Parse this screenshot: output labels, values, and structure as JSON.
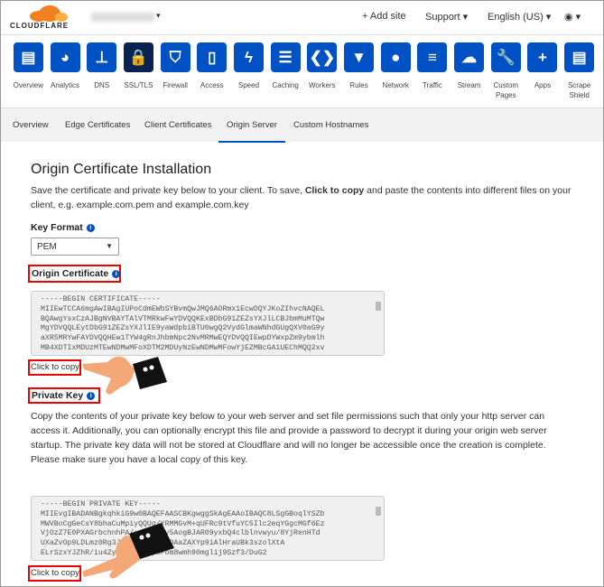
{
  "header": {
    "logo": "CLOUDFLARE",
    "add_site": "+ Add site",
    "support": "Support ▾",
    "language": "English (US) ▾",
    "user": "◉ ▾",
    "account_caret": "▾"
  },
  "nav": [
    {
      "label": "Overview",
      "icon": "clipboard-icon",
      "glyph": "▤"
    },
    {
      "label": "Analytics",
      "icon": "pie-chart-icon",
      "glyph": "◕"
    },
    {
      "label": "DNS",
      "icon": "network-tree-icon",
      "glyph": "⊥"
    },
    {
      "label": "SSL/TLS",
      "icon": "lock-icon",
      "glyph": "🔒",
      "active": true
    },
    {
      "label": "Firewall",
      "icon": "shield-icon",
      "glyph": "⛉"
    },
    {
      "label": "Access",
      "icon": "door-icon",
      "glyph": "▯"
    },
    {
      "label": "Speed",
      "icon": "lightning-icon",
      "glyph": "ϟ"
    },
    {
      "label": "Caching",
      "icon": "server-icon",
      "glyph": "☰"
    },
    {
      "label": "Workers",
      "icon": "workers-icon",
      "glyph": "❮❯"
    },
    {
      "label": "Rules",
      "icon": "filter-icon",
      "glyph": "▼"
    },
    {
      "label": "Network",
      "icon": "location-pin-icon",
      "glyph": "●"
    },
    {
      "label": "Traffic",
      "icon": "list-icon",
      "glyph": "≡"
    },
    {
      "label": "Stream",
      "icon": "cloud-play-icon",
      "glyph": "☁"
    },
    {
      "label": "Custom Pages",
      "icon": "wrench-icon",
      "glyph": "🔧"
    },
    {
      "label": "Apps",
      "icon": "plus-icon",
      "glyph": "+"
    },
    {
      "label": "Scrape Shield",
      "icon": "document-icon",
      "glyph": "▤"
    }
  ],
  "tabs": [
    "Overview",
    "Edge Certificates",
    "Client Certificates",
    "Origin Server",
    "Custom Hostnames"
  ],
  "main": {
    "title": "Origin Certificate Installation",
    "intro_1": "Save the certificate and private key below to your client. To save, ",
    "intro_bold": "Click to copy",
    "intro_2": " and paste the contents into different files on your client, e.g. example.com.pem and example.com.key",
    "key_format_label": "Key Format",
    "key_format_value": "PEM",
    "origin_cert_label": "Origin Certificate",
    "origin_cert_text": "-----BEGIN CERTIFICATE-----\nMIIEwTCCA6mgAwIBAgIUPoCdmEWbSYBvmQwJMQ6AORmx1EcwDQYJKoZIhvcNAQEL\nBQAwgYsxCzAJBgNVBAYTAlVTMRkwFwYDVQQKExBDbG91ZEZsYXJlLCBJbmMuMTQw\nMgYDVQQLEytDbG91ZEZsYXJlIE9yaWdpbiBTU0wgQ2VydGlmaWNhdGUgQXV0aG9y\naXR5MRYwFAYDVQQHEw1TYW4gRnJhbmNpc2NvMRMwEQYDVQQIEwpDYWxpZm9ybmlh\nMB4XDTIxMDUzMTEwNDMwMFoXDTM2MDUyNzEwNDMwMFowYjEZMBcGA1UEChMQQ2xv",
    "copy_label": "Click to copy",
    "private_key_label": "Private Key",
    "private_key_desc": "Copy the contents of your private key below to your web server and set file permissions such that only your http server can access it. Additionally, you can optionally encrypt this file and provide a password to decrypt it during your origin web server startup. The private key data will not be stored at Cloudflare and will no longer be accessible once the creation is complete. Please make sure you have a local copy of this key.",
    "private_key_text": "-----BEGIN PRIVATE KEY-----\nMIIEvgIBADANBgkqhkiG9w0BAQEFAASCBKgwggSkAgEAAoIBAQC8LSgGBoqlYSZb\nMWVBoCgGeCsY8bhaCuMpiyQQUg/YRMMGvM+qUFRc9tVfuYC5Ilc2eqYGgcMGf6Ez\nVjOzZ7E0PXAGrbchnhPA/+g+9oM4v5AogBJAR09yxbQ4clblnvwyu/8YjRenHTd\nUXaZvOp9LDLmz0Rg3JiogrSjhfEgdOAaZAXYp9iAlHraUBk3szolXtA\nELrSzxYJZhR/iu4ZyPe+XxNv6pOFom8wmh90mglij9Szf3/DuG2"
  },
  "colors": {
    "accent": "#0051c3",
    "active_nav": "#0a2250",
    "highlight": "#e00000",
    "logo": "#f38020"
  }
}
